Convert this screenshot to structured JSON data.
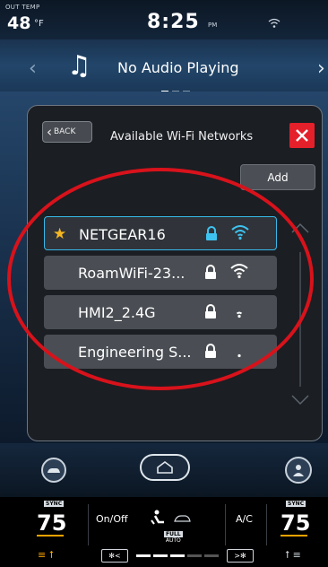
{
  "status": {
    "out_temp_label": "OUT TEMP",
    "out_temp": "48",
    "out_temp_unit": "°F",
    "time": "8:25",
    "ampm": "PM"
  },
  "audio": {
    "status_text": "No Audio Playing"
  },
  "wifi_panel": {
    "back_label": "BACK",
    "title": "Available Wi-Fi Networks",
    "add_label": "Add",
    "networks": [
      {
        "name": "NETGEAR16",
        "favorite": true,
        "locked": true,
        "signal": 3,
        "selected": true
      },
      {
        "name": "RoamWiFi-23...",
        "favorite": false,
        "locked": true,
        "signal": 3,
        "selected": false
      },
      {
        "name": "HMI2_2.4G",
        "favorite": false,
        "locked": true,
        "signal": 1,
        "selected": false
      },
      {
        "name": "Engineering S...",
        "favorite": false,
        "locked": true,
        "signal": 0,
        "selected": false
      }
    ]
  },
  "climate": {
    "sync_label": "SYNC",
    "left_temp": "75",
    "right_temp": "75",
    "onoff_label": "On/Off",
    "ac_label": "A/C",
    "full_label": "FULL",
    "auto_label": "AUTO"
  },
  "colors": {
    "accent_blue": "#37b9ea",
    "close_red": "#e4202a",
    "star_gold": "#f6b621",
    "heat_orange": "#f7a300",
    "annotation_red": "#d8121b"
  }
}
